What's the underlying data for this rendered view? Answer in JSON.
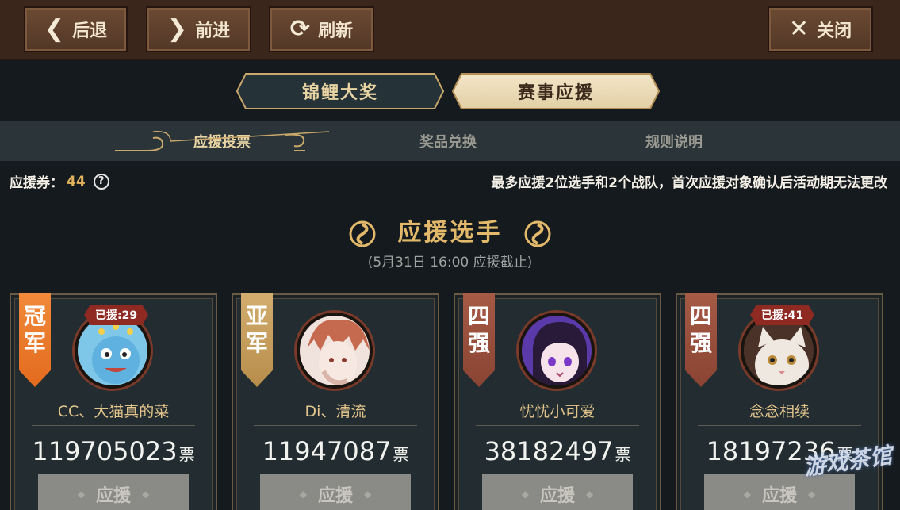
{
  "toolbar": {
    "back_label": "后退",
    "forward_label": "前进",
    "refresh_label": "刷新",
    "close_label": "关闭"
  },
  "main_tabs": [
    {
      "label": "锦鲤大奖",
      "active": false
    },
    {
      "label": "赛事应援",
      "active": true
    }
  ],
  "sub_tabs": [
    {
      "label": "应援投票",
      "active": true
    },
    {
      "label": "奖品兑换",
      "active": false
    },
    {
      "label": "规则说明",
      "active": false
    }
  ],
  "info": {
    "voucher_label": "应援券：",
    "voucher_count": "44",
    "help_symbol": "?",
    "notice": "最多应援2位选手和2个战队，首次应援对象确认后活动期无法更改"
  },
  "section": {
    "title": "应援选手",
    "deadline": "(5月31日 16:00 应援截止)"
  },
  "players": [
    {
      "rank_line1": "冠",
      "rank_line2": "军",
      "badge": "已援:29",
      "name": "CC、大猫真的菜",
      "votes": "119705023",
      "unit": "票",
      "button": "应援",
      "rank_style": "champ"
    },
    {
      "rank_line1": "亚",
      "rank_line2": "军",
      "badge": "",
      "name": "Di、清流",
      "votes": "11947087",
      "unit": "票",
      "button": "应援",
      "rank_style": "runner"
    },
    {
      "rank_line1": "四",
      "rank_line2": "强",
      "badge": "",
      "name": "忧忧小可爱",
      "votes": "38182497",
      "unit": "票",
      "button": "应援",
      "rank_style": "top4"
    },
    {
      "rank_line1": "四",
      "rank_line2": "强",
      "badge": "已援:41",
      "name": "念念相续",
      "votes": "18197236",
      "unit": "票",
      "button": "应援",
      "rank_style": "top4"
    }
  ],
  "watermark": "游戏茶馆",
  "colors": {
    "accent_gold": "#e2b96a",
    "topbar_brown": "#3a261a",
    "badge_red": "#8f2a22"
  }
}
